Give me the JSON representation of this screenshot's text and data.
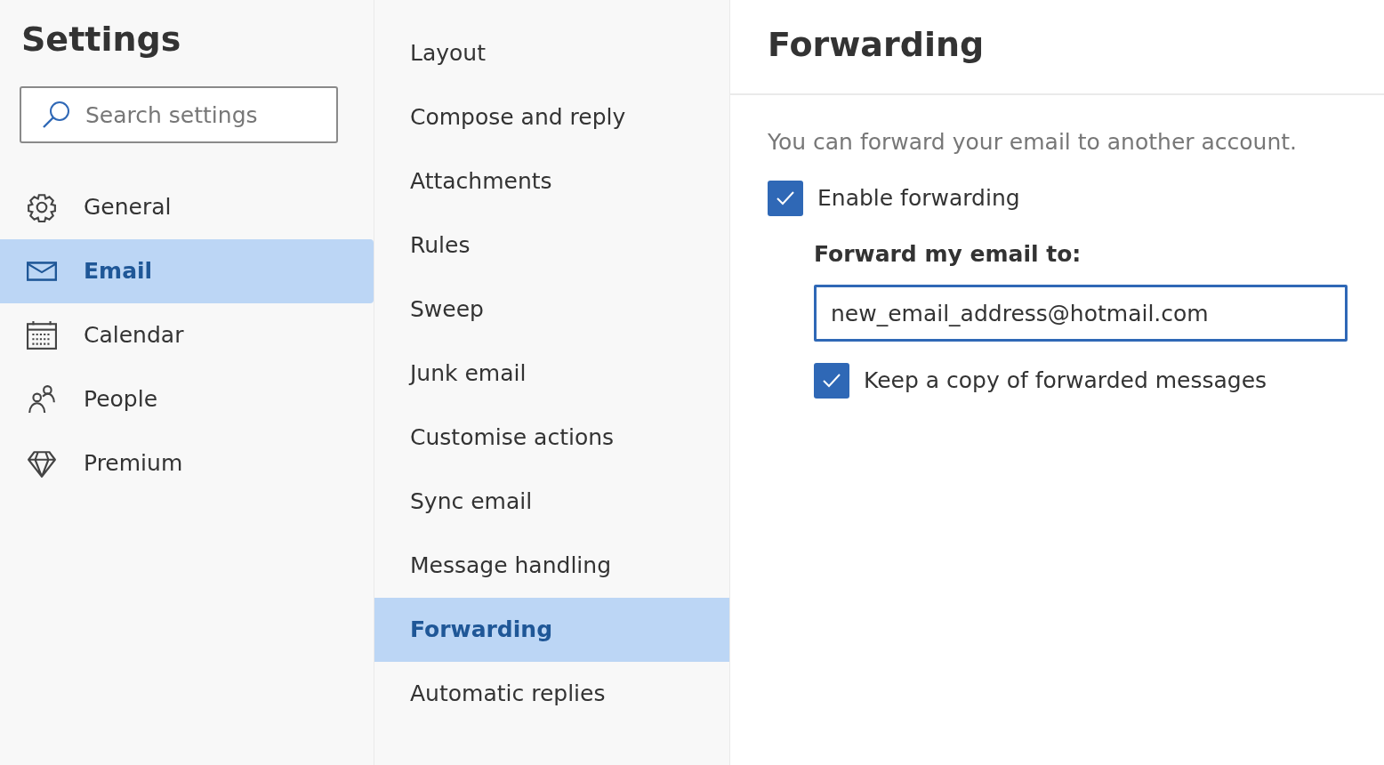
{
  "settings": {
    "title": "Settings",
    "search": {
      "placeholder": "Search settings"
    },
    "categories": [
      {
        "label": "General",
        "selected": false
      },
      {
        "label": "Email",
        "selected": true
      },
      {
        "label": "Calendar",
        "selected": false
      },
      {
        "label": "People",
        "selected": false
      },
      {
        "label": "Premium",
        "selected": false
      }
    ]
  },
  "subcategories": [
    {
      "label": "Layout",
      "selected": false
    },
    {
      "label": "Compose and reply",
      "selected": false
    },
    {
      "label": "Attachments",
      "selected": false
    },
    {
      "label": "Rules",
      "selected": false
    },
    {
      "label": "Sweep",
      "selected": false
    },
    {
      "label": "Junk email",
      "selected": false
    },
    {
      "label": "Customise actions",
      "selected": false
    },
    {
      "label": "Sync email",
      "selected": false
    },
    {
      "label": "Message handling",
      "selected": false
    },
    {
      "label": "Forwarding",
      "selected": true
    },
    {
      "label": "Automatic replies",
      "selected": false
    }
  ],
  "pane": {
    "title": "Forwarding",
    "description": "You can forward your email to another account.",
    "enable": {
      "label": "Enable forwarding",
      "checked": true
    },
    "forward_label": "Forward my email to:",
    "forward_field": {
      "value": "new_email_address@hotmail.com"
    },
    "keep_copy": {
      "label": "Keep a copy of forwarded messages",
      "checked": true
    }
  }
}
